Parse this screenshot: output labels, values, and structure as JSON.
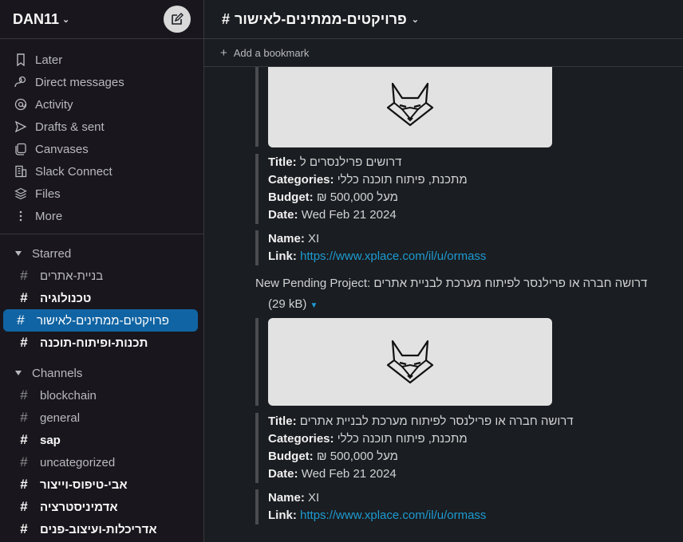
{
  "workspace": {
    "name": "DAN11"
  },
  "nav": [
    {
      "icon": "bookmark-icon",
      "label": "Later"
    },
    {
      "icon": "direct-messages-icon",
      "label": "Direct messages"
    },
    {
      "icon": "activity-icon",
      "label": "Activity"
    },
    {
      "icon": "send-icon",
      "label": "Drafts & sent"
    },
    {
      "icon": "canvas-icon",
      "label": "Canvases"
    },
    {
      "icon": "building-icon",
      "label": "Slack Connect"
    },
    {
      "icon": "files-icon",
      "label": "Files"
    },
    {
      "icon": "more-icon",
      "label": "More"
    }
  ],
  "starred": {
    "title": "Starred",
    "channels": [
      "בניית-אתרים",
      "טכנולוגיה",
      "פרויקטים-ממתינים-לאישור",
      "תכנות-ופיתוח-תוכנה"
    ]
  },
  "channels": {
    "title": "Channels",
    "list": [
      "blockchain",
      "general",
      "sap",
      "uncategorized",
      "אבי-טיפוס-וייצור",
      "אדמיניסטרציה",
      "אדריכלות-ועיצוב-פנים"
    ]
  },
  "header": {
    "channel_name": "פרויקטים-ממתינים-לאישור",
    "add_bookmark": "Add a bookmark"
  },
  "messages": {
    "first": {
      "title_label": "Title:",
      "title_value": "דרושים פרילנסרים ל",
      "categories_label": "Categories:",
      "categories_value": "מתכנת, פיתוח תוכנה כללי",
      "budget_label": "Budget:",
      "budget_value": "₪ 500,000 מעל",
      "date_label": "Date:",
      "date_value": "Wed Feb 21 2024",
      "name_label": "Name:",
      "name_value": "XI",
      "link_label": "Link:",
      "link_value": "https://www.xplace.com/il/u/ormass"
    },
    "second": {
      "pending_text": "New Pending Project: דרושה חברה או פרילנסר לפיתוח מערכת לבניית אתרים",
      "file_size": "(29 kB)",
      "title_label": "Title:",
      "title_value": "דרושה חברה או פרילנסר לפיתוח מערכת לבניית אתרים",
      "categories_label": "Categories:",
      "categories_value": "מתכנת, פיתוח תוכנה כללי",
      "budget_label": "Budget:",
      "budget_value": "₪ 500,000 מעל",
      "date_label": "Date:",
      "date_value": "Wed Feb 21 2024",
      "name_label": "Name:",
      "name_value": "XI",
      "link_label": "Link:",
      "link_value": "https://www.xplace.com/il/u/ormass"
    }
  },
  "colors": {
    "accent": "#1164a3",
    "link": "#1d9bd1",
    "sidebar_bg": "#19171d",
    "main_bg": "#1a1d21"
  }
}
